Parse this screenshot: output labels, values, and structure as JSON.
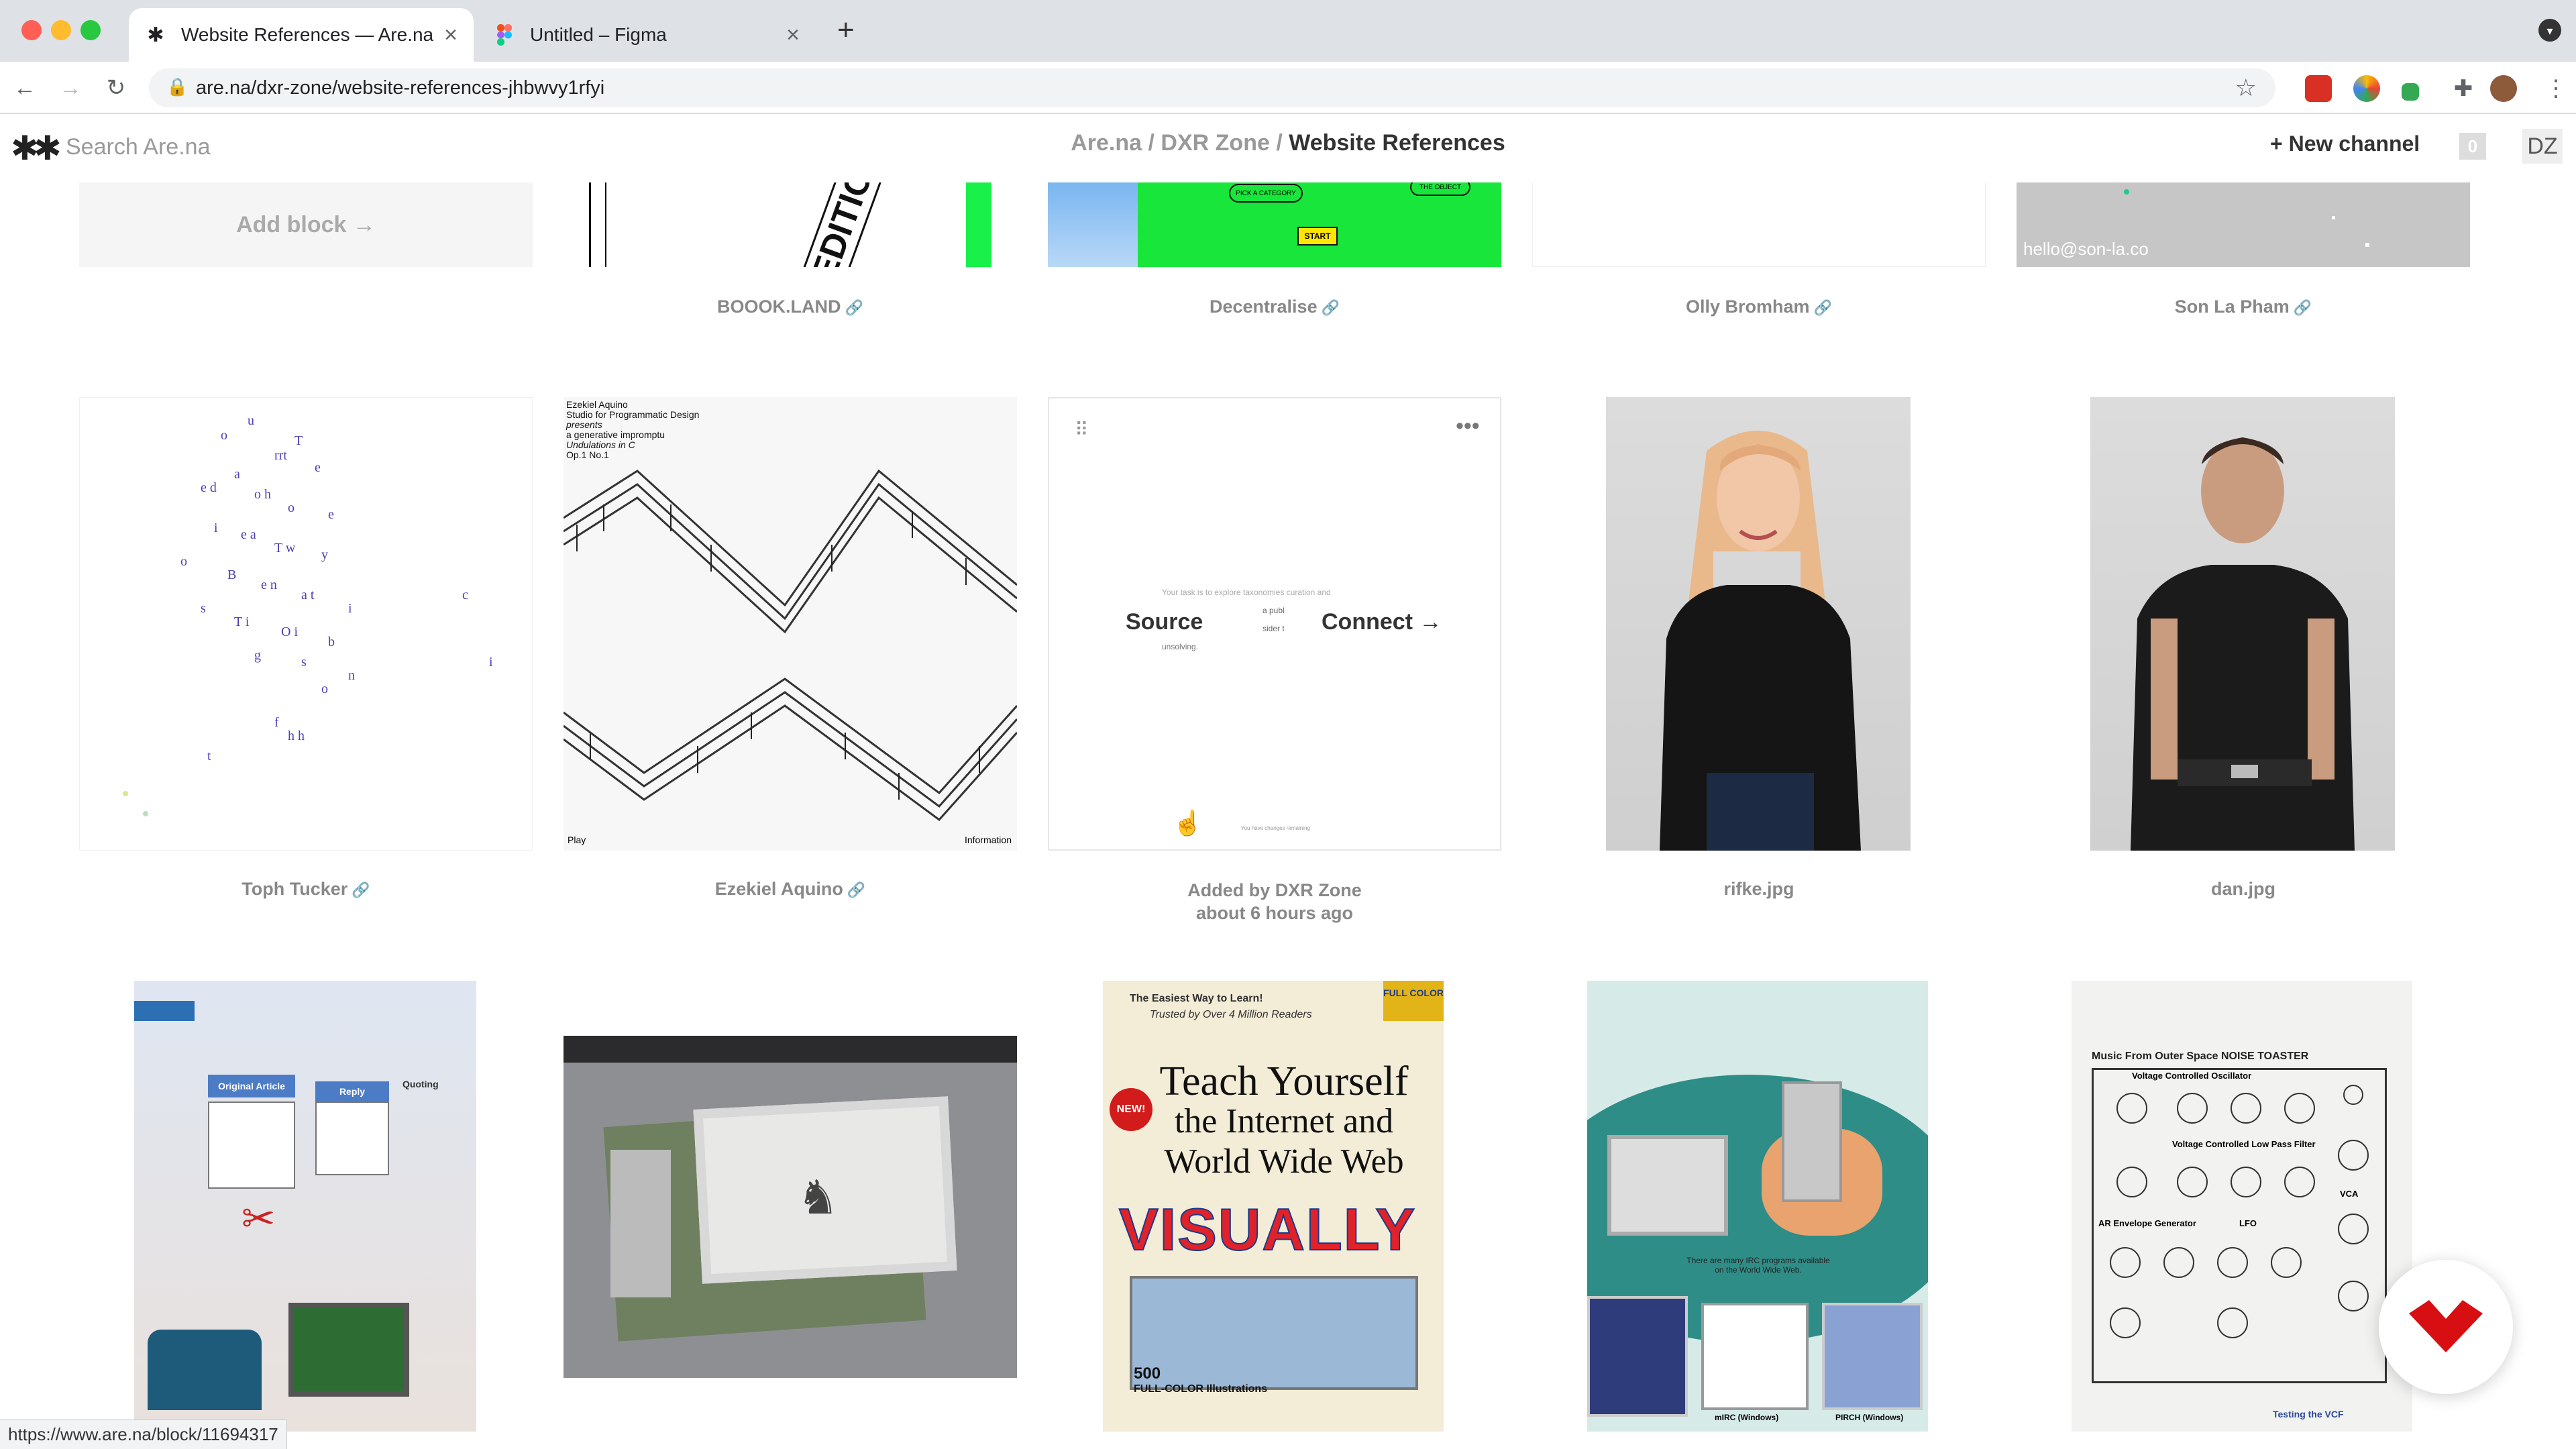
{
  "browser": {
    "tabs": [
      {
        "title": "Website References — Are.na",
        "icon": "arena-asterisk-icon",
        "active": true
      },
      {
        "title": "Untitled – Figma",
        "icon": "figma-icon",
        "active": false
      }
    ],
    "url": "are.na/dxr-zone/website-references-jhbwvy1rfyi",
    "status_url": "https://www.are.na/block/11694317",
    "colors": {
      "close": "#ff5f57",
      "minimize": "#febc2e",
      "maximize": "#28c840"
    }
  },
  "header": {
    "logo": "✱✱",
    "search_placeholder": "Search Are.na",
    "breadcrumb": {
      "root": "Are.na",
      "sep": "/",
      "owner": "DXR Zone",
      "channel": "Website References"
    },
    "new_channel_label": "New channel",
    "new_channel_icon": "+",
    "notification_count": "0",
    "user_initials": "DZ",
    "accent": "#333333"
  },
  "blocks": {
    "row1": {
      "add_block_label": "Add block →",
      "captions": [
        "BOOOK.LAND",
        "Decentralise",
        "Olly Bromham",
        "Son La Pham"
      ],
      "decentralise_button": "START",
      "decentralise_chip": "PICK A CATEGORY",
      "decentralise_chip2": "THE OBJECT",
      "boook_text": "EDITIO",
      "sonla_email": "hello@son-la.co"
    },
    "row2": {
      "captions": [
        "Toph Tucker",
        "Ezekiel Aquino",
        "rifke.jpg",
        "dan.jpg"
      ],
      "added_by": "Added by DXR Zone",
      "added_time": "about 6 hours ago",
      "hover_source": "Source",
      "hover_connect": "Connect →",
      "ezekiel_lines": [
        "Ezekiel Aquino",
        "Studio for Programmatic Design",
        "presents",
        "a generative impromptu",
        "Undulations in C",
        "Op.1 No.1"
      ],
      "ezekiel_play": "Play",
      "ezekiel_info": "Information",
      "text_block_lines": [
        "Your task is to explore  taxonomies  curation  and",
        "a publ",
        "sider t",
        "unsolving."
      ],
      "text_block_footer": "You have  changes remaining"
    },
    "row3": {
      "book_tagline": "The Easiest Way to Learn!",
      "book_trusted": "Trusted by Over 4 Million Readers",
      "book_new": "NEW!",
      "book_title_1": "Teach Yourself",
      "book_title_2": "the Internet and",
      "book_title_3": "World Wide Web",
      "book_visually": "VISUALLY",
      "book_500": "500",
      "book_full": "FULL-COLOR Illustrations",
      "book_corner": "FULL COLOR",
      "noise_title": "Music From Outer Space   NOISE TOASTER",
      "noise_sections": [
        "Voltage Controlled Oscillator",
        "Voltage Controlled Low Pass Filter",
        "AR Envelope Generator",
        "LFO",
        "VCA"
      ],
      "noise_caption": "Testing the VCF",
      "article_heading_1": "Original Article",
      "article_heading_2": "Reply",
      "article_heading_3": "Quoting",
      "irc_captions": [
        "mIRC (Windows)",
        "PIRCH (Windows)"
      ],
      "irc_note": "There are many IRC programs available on the World Wide Web."
    }
  }
}
